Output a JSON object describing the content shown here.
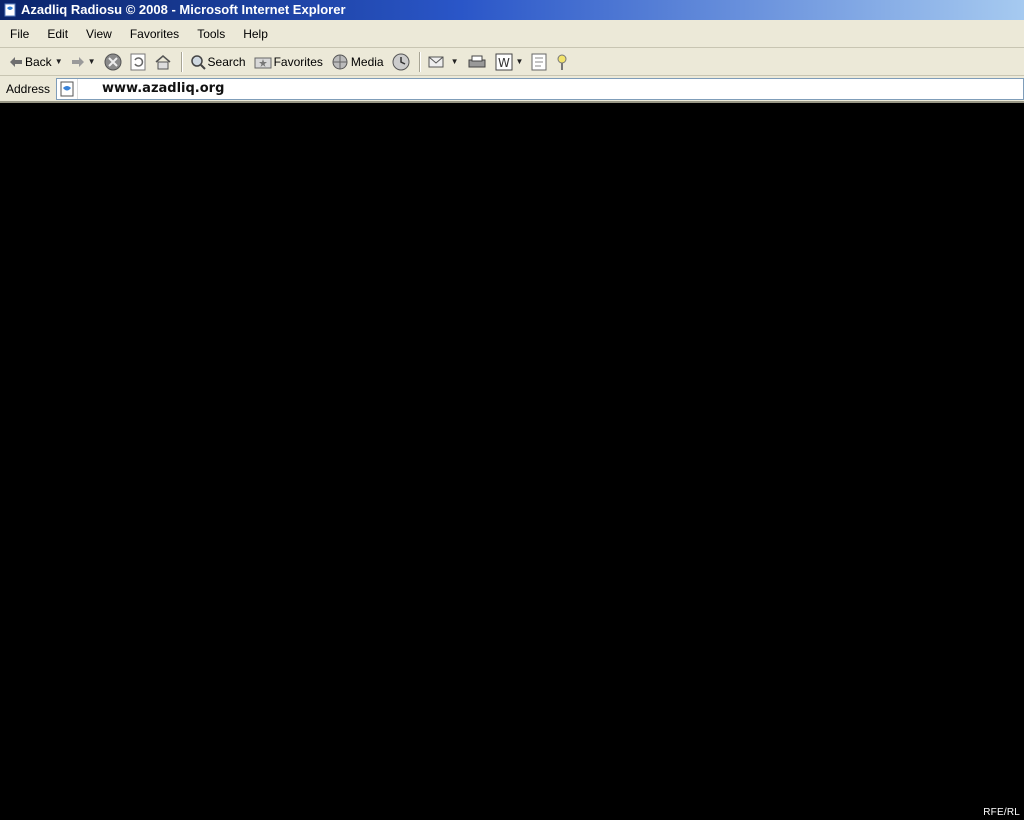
{
  "window": {
    "title": "Azadliq Radiosu © 2008 - Microsoft Internet Explorer",
    "icon": "ie-page-icon"
  },
  "menu": {
    "items": [
      "File",
      "Edit",
      "View",
      "Favorites",
      "Tools",
      "Help"
    ]
  },
  "toolbar": {
    "back_label": "Back",
    "search_label": "Search",
    "favorites_label": "Favorites",
    "media_label": "Media",
    "icons": [
      "back-arrow-icon",
      "forward-arrow-icon",
      "stop-icon",
      "refresh-icon",
      "home-icon",
      "search-icon",
      "favorites-icon",
      "media-icon",
      "history-icon",
      "mail-icon",
      "print-icon",
      "word-icon",
      "discuss-icon",
      "messenger-icon"
    ]
  },
  "address": {
    "label": "Address",
    "url": "www.azadliq.org"
  },
  "content": {
    "background": "#000000",
    "credit": "RFE/RL"
  },
  "colors": {
    "titlebar_start": "#0a246a",
    "titlebar_end": "#a6caf0",
    "chrome": "#ece9d8"
  }
}
